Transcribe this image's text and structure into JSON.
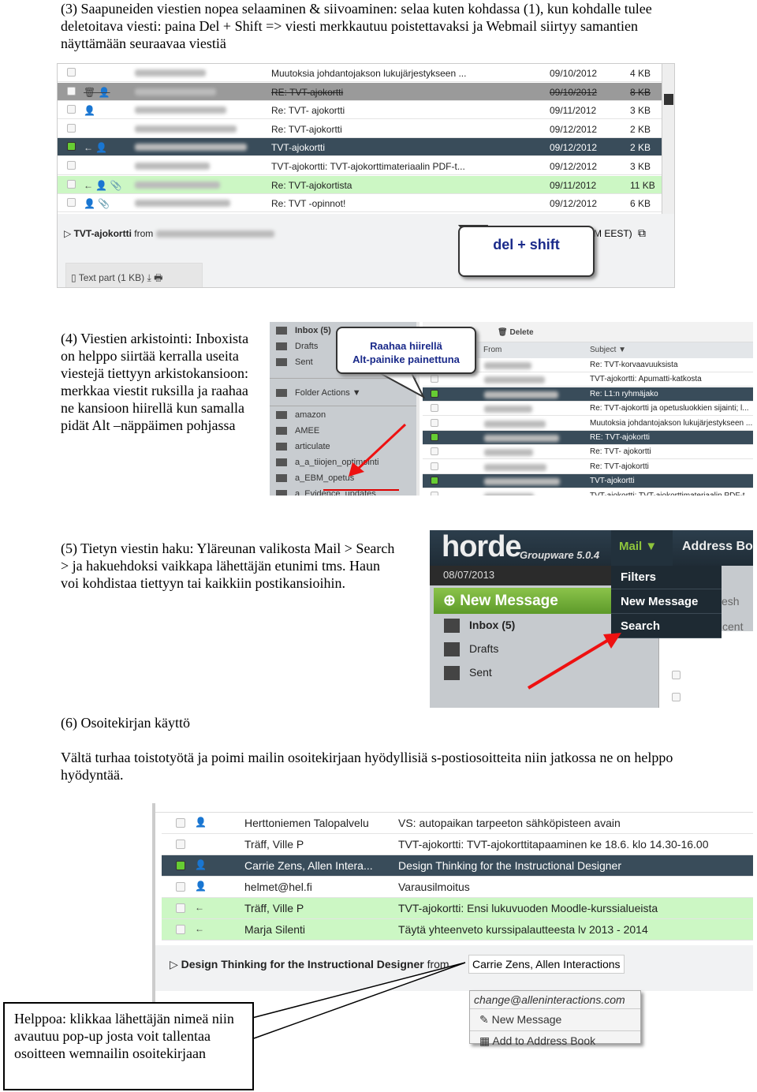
{
  "section3": {
    "text": "(3) Saapuneiden viestien nopea selaaminen & siivoaminen:  selaa kuten kohdassa (1), kun kohdalle tulee deletoitava viesti:  paina Del + Shift => viesti merkkautuu poistettavaksi ja Webmail siirtyy samantien näyttämään seuraavaa viestiä",
    "messages": [
      {
        "subject": "Muutoksia johdantojakson lukujärjestykseen ...",
        "date": "09/10/2012",
        "size": "4 KB",
        "style": "",
        "checked": false,
        "icons": ""
      },
      {
        "subject": "RE: TVT-ajokortti",
        "date": "09/10/2012",
        "size": "8 KB",
        "style": "grey strike",
        "checked": false,
        "icons": "🗑 👤"
      },
      {
        "subject": "Re: TVT- ajokortti",
        "date": "09/11/2012",
        "size": "3 KB",
        "style": "",
        "checked": false,
        "icons": "👤"
      },
      {
        "subject": "Re: TVT-ajokortti",
        "date": "09/12/2012",
        "size": "2 KB",
        "style": "",
        "checked": false,
        "icons": ""
      },
      {
        "subject": "TVT-ajokortti",
        "date": "09/12/2012",
        "size": "2 KB",
        "style": "dark",
        "checked": true,
        "icons": "← 👤"
      },
      {
        "subject": "TVT-ajokortti: TVT-ajokorttimateriaalin PDF-t...",
        "date": "09/12/2012",
        "size": "3 KB",
        "style": "",
        "checked": false,
        "icons": ""
      },
      {
        "subject": "Re: TVT-ajokortista",
        "date": "09/11/2012",
        "size": "11 KB",
        "style": "green",
        "checked": false,
        "icons": "← 👤 📎"
      },
      {
        "subject": "Re: TVT -opinnot!",
        "date": "09/12/2012",
        "size": "6 KB",
        "style": "",
        "checked": false,
        "icons": "👤 📎"
      }
    ],
    "preview_subject": "TVT-ajokortti",
    "preview_from": "from",
    "preview_time": "M EEST)",
    "attachment": "Text part (1 KB)",
    "callout": "del + shift"
  },
  "section4": {
    "text": "(4) Viestien arkistointi: Inboxista on helppo siirtää kerralla useita viestejä tiettyyn arkistokansioon:  merkkaa viestit ruksilla ja raahaa ne kansioon hiirellä kun samalla pidät Alt –näppäimen pohjassa",
    "folders_top": [
      "Inbox (5)",
      "Drafts",
      "Sent"
    ],
    "folder_actions": "Folder Actions ▼",
    "folders": [
      "amazon",
      "AMEE",
      "articulate",
      "a_a_tiiojen_optimointi",
      "a_EBM_opetus",
      "a_Evidence_updates"
    ],
    "toolbar_delete": "Delete",
    "col_from": "From",
    "col_subject": "Subject ▼",
    "messages": [
      {
        "subject": "Re: TVT-korvaavuuksista",
        "checked": false,
        "dark": false
      },
      {
        "subject": "TVT-ajokortti: Apumatti-katkosta",
        "checked": false,
        "dark": false
      },
      {
        "subject": "Re: L1:n ryhmäjako",
        "checked": true,
        "dark": true
      },
      {
        "subject": "Re: TVT-ajokortti ja opetusluokkien sijainti; l...",
        "checked": false,
        "dark": false
      },
      {
        "subject": "Muutoksia johdantojakson lukujärjestykseen ...",
        "checked": false,
        "dark": false
      },
      {
        "subject": "RE: TVT-ajokortti",
        "checked": true,
        "dark": true
      },
      {
        "subject": "Re: TVT- ajokortti",
        "checked": false,
        "dark": false
      },
      {
        "subject": "Re: TVT-ajokortti",
        "checked": false,
        "dark": false
      },
      {
        "subject": "TVT-ajokortti",
        "checked": true,
        "dark": true
      },
      {
        "subject": "TVT-ajokortti: TVT-ajokorttimateriaalin PDF-t",
        "checked": false,
        "dark": false
      }
    ],
    "callout_line1": "Raahaa hiirellä",
    "callout_line2": "Alt-painike painettuna"
  },
  "section5": {
    "text": " (5)  Tietyn viestin haku:  Yläreunan valikosta  Mail > Search >  ja hakuehdoksi  vaikkapa lähettäjän etunimi tms.  Haun voi kohdistaa tiettyyn tai kaikkiin postikansioihin.",
    "logo": "horde",
    "product": "Groupware 5.0.4",
    "date": "08/07/2013",
    "new_message": "New Message",
    "folders": [
      "Inbox (5)",
      "Drafts",
      "Sent"
    ],
    "menu_mail": "Mail ▼",
    "menu_address": "Address Bo",
    "dropdown": [
      "Filters",
      "New Message",
      "Search"
    ],
    "bg_refresh": "esh",
    "bg_recent": "cent"
  },
  "section6": {
    "heading": "(6) Osoitekirjan käyttö",
    "text": "Vältä turhaa toistotyötä ja poimi mailin osoitekirjaan hyödyllisiä s-postiosoitteita niin jatkossa ne on helppo hyödyntää.",
    "messages": [
      {
        "from": "Herttoniemen Talopalvelu",
        "subject": "VS: autopaikan tarpeeton sähköpisteen avain",
        "style": "",
        "checked": false,
        "icons": "👤"
      },
      {
        "from": "Träff, Ville P",
        "subject": "TVT-ajokortti: TVT-ajokorttitapaaminen ke 18.6. klo 14.30-16.00",
        "style": "",
        "checked": false,
        "icons": ""
      },
      {
        "from": "Carrie Zens, Allen Intera...",
        "subject": "Design Thinking for the Instructional Designer",
        "style": "dark",
        "checked": true,
        "icons": "👤"
      },
      {
        "from": "helmet@hel.fi",
        "subject": "Varausilmoitus",
        "style": "",
        "checked": false,
        "icons": "👤"
      },
      {
        "from": "Träff, Ville P",
        "subject": "TVT-ajokortti: Ensi lukuvuoden Moodle-kurssialueista",
        "style": "green",
        "checked": false,
        "icons": "←"
      },
      {
        "from": "Marja Silenti",
        "subject": "Täytä yhteenveto kurssipalautteesta lv 2013 - 2014",
        "style": "green",
        "checked": false,
        "icons": "←"
      }
    ],
    "preview_subject": "Design Thinking for the Instructional Designer",
    "preview_from": "from",
    "sender": "Carrie Zens, Allen Interactions",
    "popup_email": "change@alleninteractions.com",
    "popup_new": "New Message",
    "popup_add": "Add to Address Book",
    "hint": "Helppoa: klikkaa lähettäjän nimeä niin avautuu pop-up josta voit tallentaa osoitteen wemnailin osoitekirjaan"
  }
}
